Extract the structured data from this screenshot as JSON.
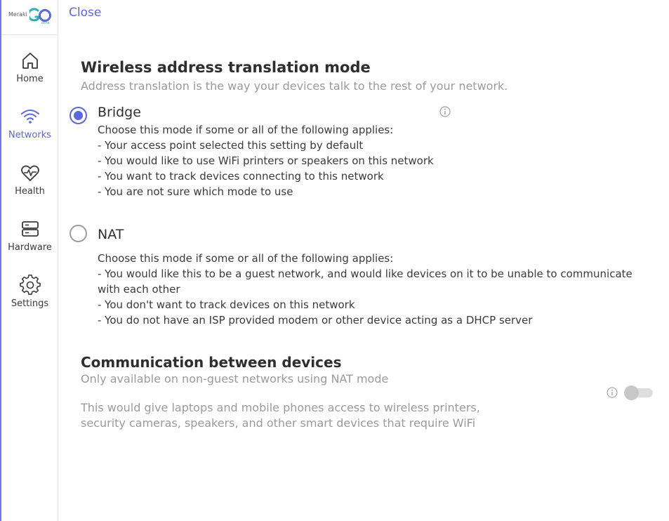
{
  "app": {
    "logo_text": "Meraki",
    "logo_beta": "beta",
    "logo_mark": "GO"
  },
  "sidebar": {
    "items": [
      {
        "label": "Home",
        "icon": "home-icon",
        "active": false
      },
      {
        "label": "Networks",
        "icon": "wifi-icon",
        "active": true
      },
      {
        "label": "Health",
        "icon": "heart-pulse-icon",
        "active": false
      },
      {
        "label": "Hardware",
        "icon": "server-icon",
        "active": false
      },
      {
        "label": "Settings",
        "icon": "gear-icon",
        "active": false
      }
    ]
  },
  "header": {
    "close_label": "Close"
  },
  "translation": {
    "title": "Wireless address translation mode",
    "subtitle": "Address translation is the way your devices talk to the rest of your network.",
    "options": [
      {
        "label": "Bridge",
        "selected": true,
        "lines": [
          "Choose this mode if some or all of the following applies:",
          "- Your access point selected this setting by default",
          "- You would like to use WiFi printers or speakers on this network",
          "- You want to track devices connecting to this network",
          "- You are not sure which mode to use"
        ]
      },
      {
        "label": "NAT",
        "selected": false,
        "lines": [
          "Choose this mode if some or all of the following applies:",
          "- You would like this to be a guest network, and would like devices on it to be unable to communicate with each other",
          "- You don't want to track devices on this network",
          "- You do not have an ISP provided modem or other device acting as a DHCP server"
        ]
      }
    ]
  },
  "communication": {
    "title": "Communication between devices",
    "subtitle": "Only available on non-guest networks using NAT mode",
    "description_lines": [
      "This would give laptops and mobile phones access to wireless printers,",
      "security cameras, speakers, and other smart devices that require WiFi"
    ],
    "enabled": false
  },
  "colors": {
    "accent": "#5b66e0",
    "muted_text": "#9a9a9a"
  }
}
